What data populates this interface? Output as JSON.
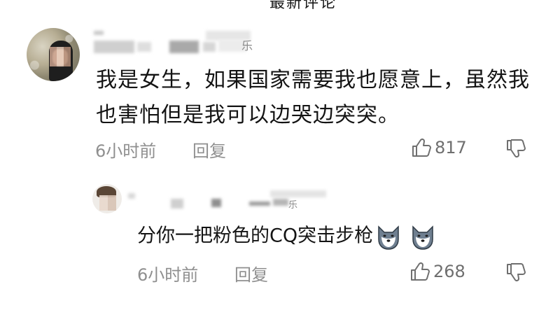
{
  "header": {
    "cut_title": "最新评论"
  },
  "comment": {
    "username_tail": "乐",
    "text": "我是女生，如果国家需要我也愿意上，虽然我也害怕但是我可以边哭边突突。",
    "time": "6小时前",
    "reply_label": "回复",
    "likes": "817"
  },
  "reply": {
    "username_tail": "乐",
    "text": "分你一把粉色的CQ突击步枪",
    "emoji": [
      "doge-icon",
      "doge-icon"
    ],
    "time": "6小时前",
    "reply_label": "回复",
    "likes": "268"
  },
  "colors": {
    "text": "#141414",
    "meta": "#8f8f8f",
    "icon": "#6f6f6f"
  }
}
